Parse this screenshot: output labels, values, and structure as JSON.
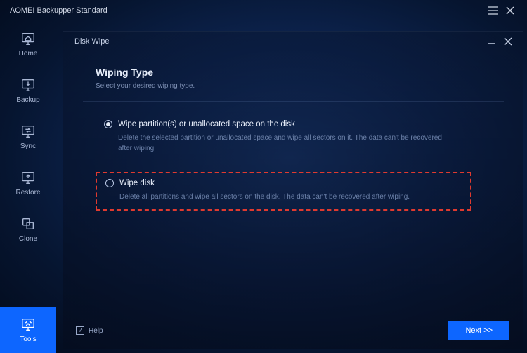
{
  "titlebar": {
    "title": "AOMEI Backupper Standard"
  },
  "sidebar": {
    "items": [
      {
        "label": "Home"
      },
      {
        "label": "Backup"
      },
      {
        "label": "Sync"
      },
      {
        "label": "Restore"
      },
      {
        "label": "Clone"
      },
      {
        "label": "Tools"
      }
    ]
  },
  "dialog": {
    "title": "Disk Wipe",
    "section_title": "Wiping Type",
    "section_sub": "Select your desired wiping type.",
    "option1": {
      "label": "Wipe partition(s) or unallocated space on the disk",
      "desc": "Delete the selected partition or unallocated space and wipe all sectors on it. The data can't be recovered after wiping."
    },
    "option2": {
      "label": "Wipe disk",
      "desc": "Delete all partitions and wipe all sectors on the disk. The data can't be recovered after wiping."
    },
    "help_label": "Help",
    "next_label": "Next >>"
  }
}
